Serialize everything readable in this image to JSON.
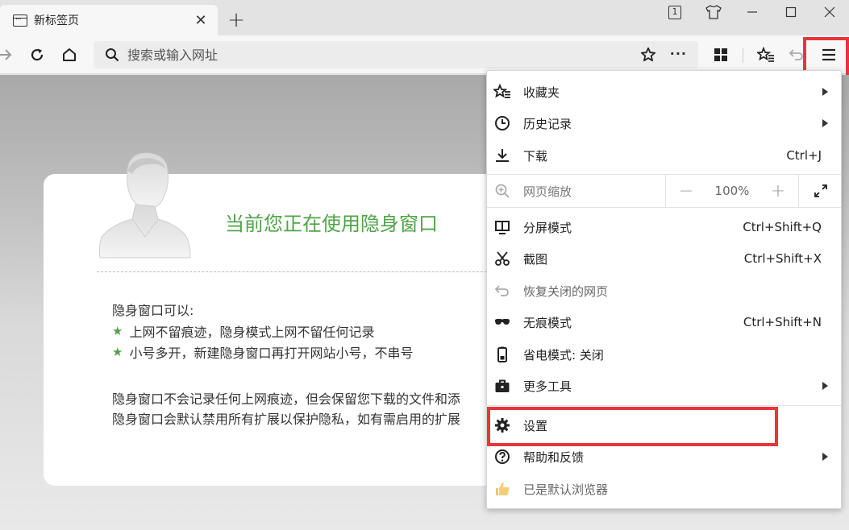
{
  "tab": {
    "title": "新标签页"
  },
  "window": {
    "tab_count": "1"
  },
  "address_bar": {
    "placeholder": "搜索或输入网址"
  },
  "incognito": {
    "title": "当前您正在使用隐身窗口",
    "can_title": "隐身窗口可以:",
    "features": [
      "上网不留痕迹，隐身模式上网不留任何记录",
      "小号多开，新建隐身窗口再打开网站小号，不串号"
    ],
    "note1": "隐身窗口不会记录任何上网痕迹，但会保留您下载的文件和添",
    "note2": "隐身窗口会默认禁用所有扩展以保护隐私，如有需启用的扩展"
  },
  "menu": {
    "favorites": "收藏夹",
    "history": "历史记录",
    "downloads": "下载",
    "downloads_shortcut": "Ctrl+J",
    "zoom": "网页缩放",
    "zoom_minus": "−",
    "zoom_value": "100%",
    "zoom_plus": "+",
    "split": "分屏模式",
    "split_shortcut": "Ctrl+Shift+Q",
    "screenshot": "截图",
    "screenshot_shortcut": "Ctrl+Shift+X",
    "restore_closed": "恢复关闭的网页",
    "incognito_mode": "无痕模式",
    "incognito_shortcut": "Ctrl+Shift+N",
    "power_saving": "省电模式: 关闭",
    "more_tools": "更多工具",
    "settings": "设置",
    "help": "帮助和反馈",
    "default_browser": "已是默认浏览器"
  },
  "colors": {
    "accent_green": "#4fa447",
    "highlight_red": "#e8353b"
  }
}
